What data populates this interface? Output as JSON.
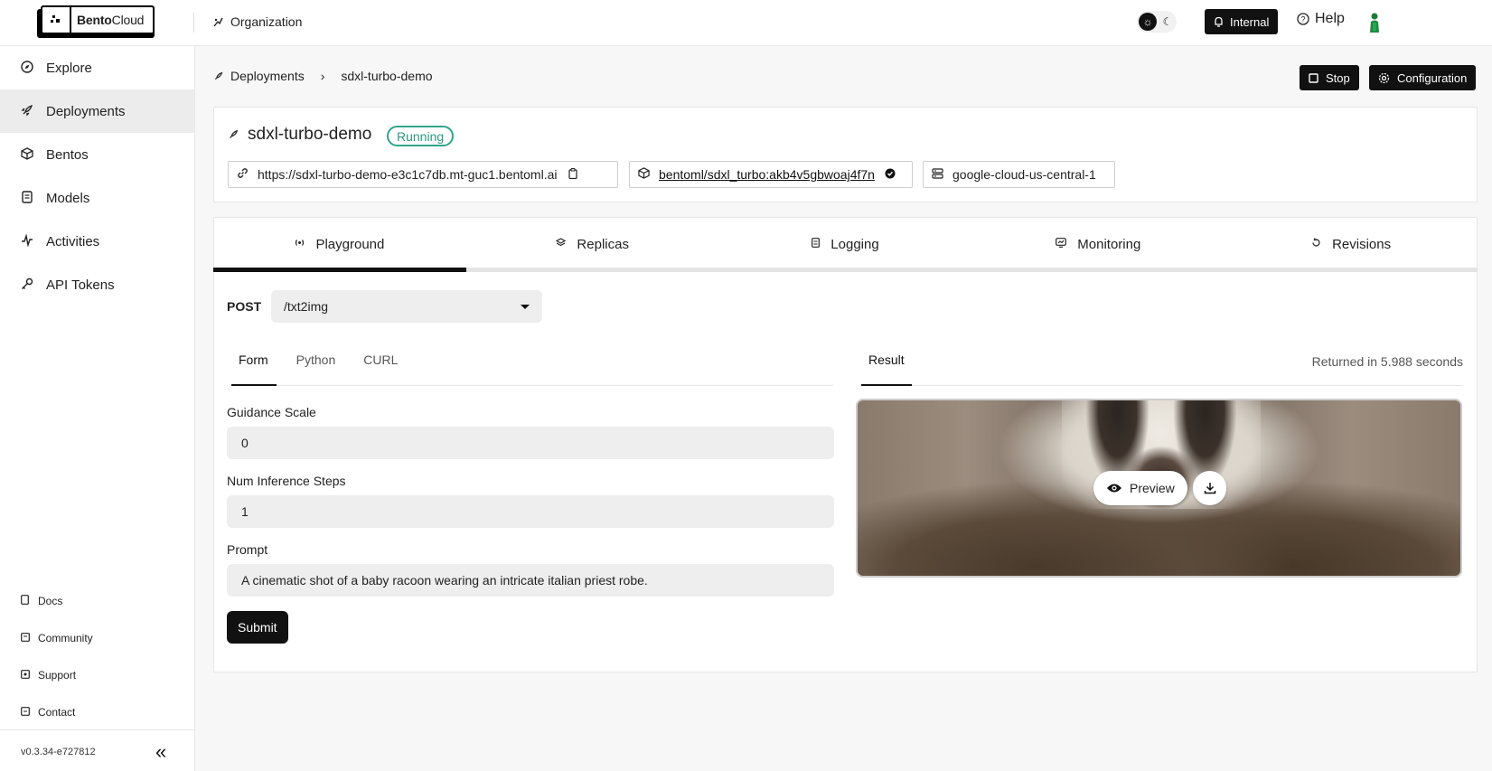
{
  "header": {
    "logo_bold": "Bento",
    "logo_rest": "Cloud",
    "org_label": "Organization",
    "internal_label": "Internal",
    "help_label": "Help"
  },
  "sidebar": {
    "items": [
      {
        "label": "Explore",
        "icon": "compass-icon"
      },
      {
        "label": "Deployments",
        "icon": "rocket-icon",
        "active": true
      },
      {
        "label": "Bentos",
        "icon": "box-icon"
      },
      {
        "label": "Models",
        "icon": "document-icon"
      },
      {
        "label": "Activities",
        "icon": "activity-icon"
      },
      {
        "label": "API Tokens",
        "icon": "key-icon"
      }
    ],
    "footer": [
      {
        "label": "Docs",
        "icon": "doc-icon"
      },
      {
        "label": "Community",
        "icon": "community-icon"
      },
      {
        "label": "Support",
        "icon": "support-icon"
      },
      {
        "label": "Contact",
        "icon": "contact-icon"
      }
    ],
    "version": "v0.3.34-e727812"
  },
  "breadcrumb": {
    "root": "Deployments",
    "current": "sdxl-turbo-demo"
  },
  "actions": {
    "stop_label": "Stop",
    "config_label": "Configuration"
  },
  "deployment": {
    "name": "sdxl-turbo-demo",
    "status": "Running",
    "url": "https://sdxl-turbo-demo-e3c1c7db.mt-guc1.bentoml.ai",
    "bento": "bentoml/sdxl_turbo:akb4v5gbwoaj4f7n",
    "cluster": "google-cloud-us-central-1"
  },
  "tabs": [
    "Playground",
    "Replicas",
    "Logging",
    "Monitoring",
    "Revisions"
  ],
  "playground": {
    "method": "POST",
    "endpoint": "/txt2img",
    "subtabs": [
      "Form",
      "Python",
      "CURL"
    ],
    "fields": [
      {
        "label": "Guidance Scale",
        "value": "0"
      },
      {
        "label": "Num Inference Steps",
        "value": "1"
      },
      {
        "label": "Prompt",
        "value": "A cinematic shot of a baby racoon wearing an intricate italian priest robe."
      }
    ],
    "submit_label": "Submit",
    "result_tab": "Result",
    "returned_text": "Returned in 5.988 seconds",
    "preview_label": "Preview"
  },
  "colors": {
    "accent": "#111111",
    "running": "#2fa58a",
    "active_nav_bg": "#ececec"
  }
}
